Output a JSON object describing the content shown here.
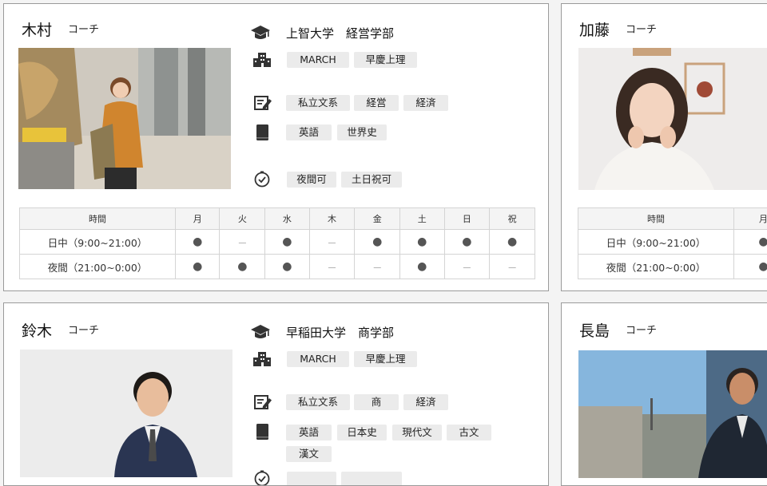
{
  "role_label": "コーチ",
  "schedule_header": [
    "時間",
    "月",
    "火",
    "水",
    "木",
    "金",
    "土",
    "日",
    "祝"
  ],
  "schedule_rows": [
    "日中（9:00~21:00）",
    "夜間（21:00~0:00）"
  ],
  "coaches": [
    {
      "name": "木村",
      "university": "上智大学　経営学部",
      "school_tags": [
        "MARCH",
        "早慶上理"
      ],
      "field_tags": [
        "私立文系",
        "経営",
        "経済"
      ],
      "subject_tags": [
        "英語",
        "世界史"
      ],
      "time_tags": [
        "夜間可",
        "土日祝可"
      ],
      "schedule": [
        [
          "●",
          "－",
          "●",
          "－",
          "●",
          "●",
          "●",
          "●"
        ],
        [
          "●",
          "●",
          "●",
          "－",
          "－",
          "●",
          "－",
          "－"
        ]
      ]
    },
    {
      "name": "加藤",
      "schedule": [
        [
          "●"
        ],
        [
          "●"
        ]
      ]
    },
    {
      "name": "鈴木",
      "university": "早稲田大学　商学部",
      "school_tags": [
        "MARCH",
        "早慶上理"
      ],
      "field_tags": [
        "私立文系",
        "商",
        "経済"
      ],
      "subject_tags": [
        "英語",
        "日本史",
        "現代文",
        "古文",
        "漢文"
      ]
    },
    {
      "name": "長島"
    }
  ]
}
